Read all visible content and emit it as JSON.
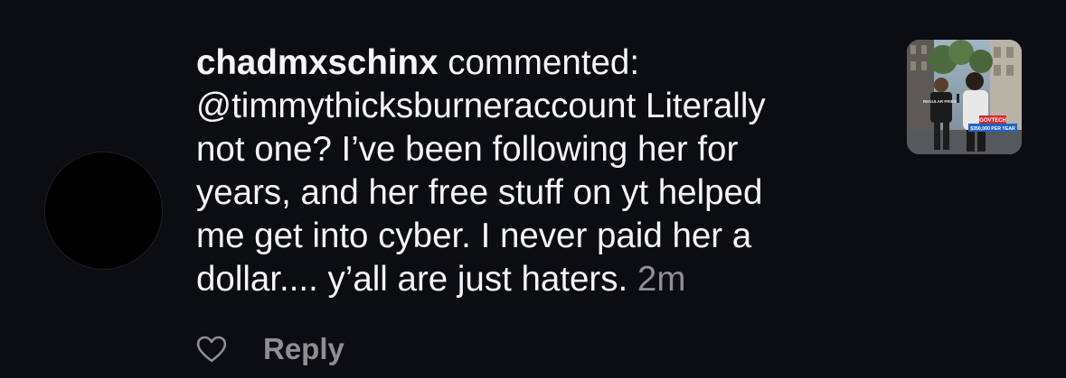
{
  "comment": {
    "username": "chadmxschinx",
    "action": "commented:",
    "lines": [
      "@timmythicksburneraccount Literally",
      "not one? I’ve been following her for",
      "years, and her free stuff on yt helped",
      "me get into cyber. I never paid her a",
      "dollar.... y’all are just haters."
    ],
    "time": "2m"
  },
  "thumbnail": {
    "shirt_text": "REGULAR FRIEND",
    "badge_top": "GOVTECH",
    "badge_bottom": "$350,000 PER YEAR",
    "badge_top_color": "#d42b2b",
    "badge_bottom_color": "#1e63c7"
  },
  "actions": {
    "like_icon": "heart-icon",
    "reply_label": "Reply"
  }
}
